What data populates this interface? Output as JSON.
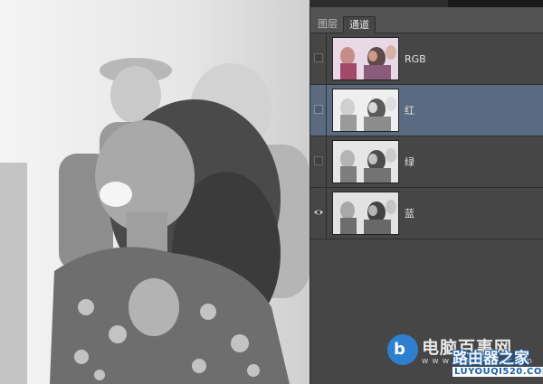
{
  "panel": {
    "tabs": [
      {
        "label": "图层",
        "active": false
      },
      {
        "label": "通道",
        "active": true
      }
    ],
    "channels": [
      {
        "label": "RGB",
        "visible": false,
        "selected": false,
        "thumb": "color"
      },
      {
        "label": "红",
        "visible": false,
        "selected": true,
        "thumb": "gray-light"
      },
      {
        "label": "绿",
        "visible": false,
        "selected": false,
        "thumb": "gray"
      },
      {
        "label": "蓝",
        "visible": true,
        "selected": false,
        "thumb": "gray-dark"
      }
    ]
  },
  "watermark": {
    "logo": "b",
    "title": "电脑百事网",
    "url": "www.pc841.com",
    "title2": "路由器之家",
    "url2": "LUYOUQI520.COM"
  },
  "colors": {
    "panel_bg": "#464646",
    "selected_row": "#5a6a80",
    "brand_blue": "#2f7fd0"
  }
}
